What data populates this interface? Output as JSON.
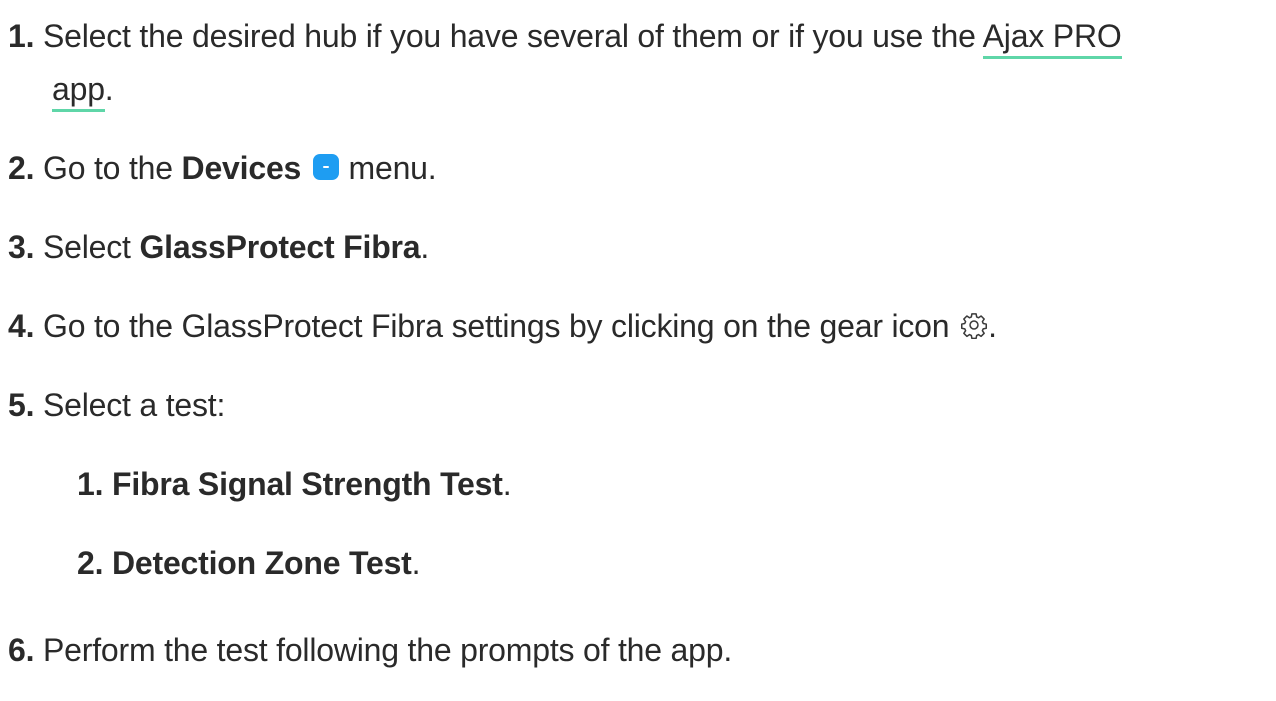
{
  "steps": [
    {
      "num": "1.",
      "line1": "Select the desired hub if you have several of them or if you use the ",
      "link_part1": "Ajax PRO",
      "link_part2": "app",
      "tail": "."
    },
    {
      "num": "2.",
      "pre": "Go to the ",
      "bold": "Devices",
      "icon": "devices-icon",
      "post": " menu."
    },
    {
      "num": "3.",
      "pre": "Select ",
      "bold": "GlassProtect Fibra",
      "post": "."
    },
    {
      "num": "4.",
      "text": "Go to the GlassProtect Fibra settings by clicking on the gear icon ",
      "icon": "gear-icon",
      "post": "."
    },
    {
      "num": "5.",
      "text": "Select a test:",
      "substeps": [
        {
          "num": "1.",
          "bold": "Fibra Signal Strength Test",
          "post": "."
        },
        {
          "num": "2.",
          "bold": "Detection Zone Test",
          "post": "."
        }
      ]
    },
    {
      "num": "6.",
      "text": "Perform the test following the prompts of the app."
    }
  ],
  "colors": {
    "text": "#2a2a2a",
    "link_underline": "#5fd6a8",
    "devices_icon": "#1e9df2"
  }
}
